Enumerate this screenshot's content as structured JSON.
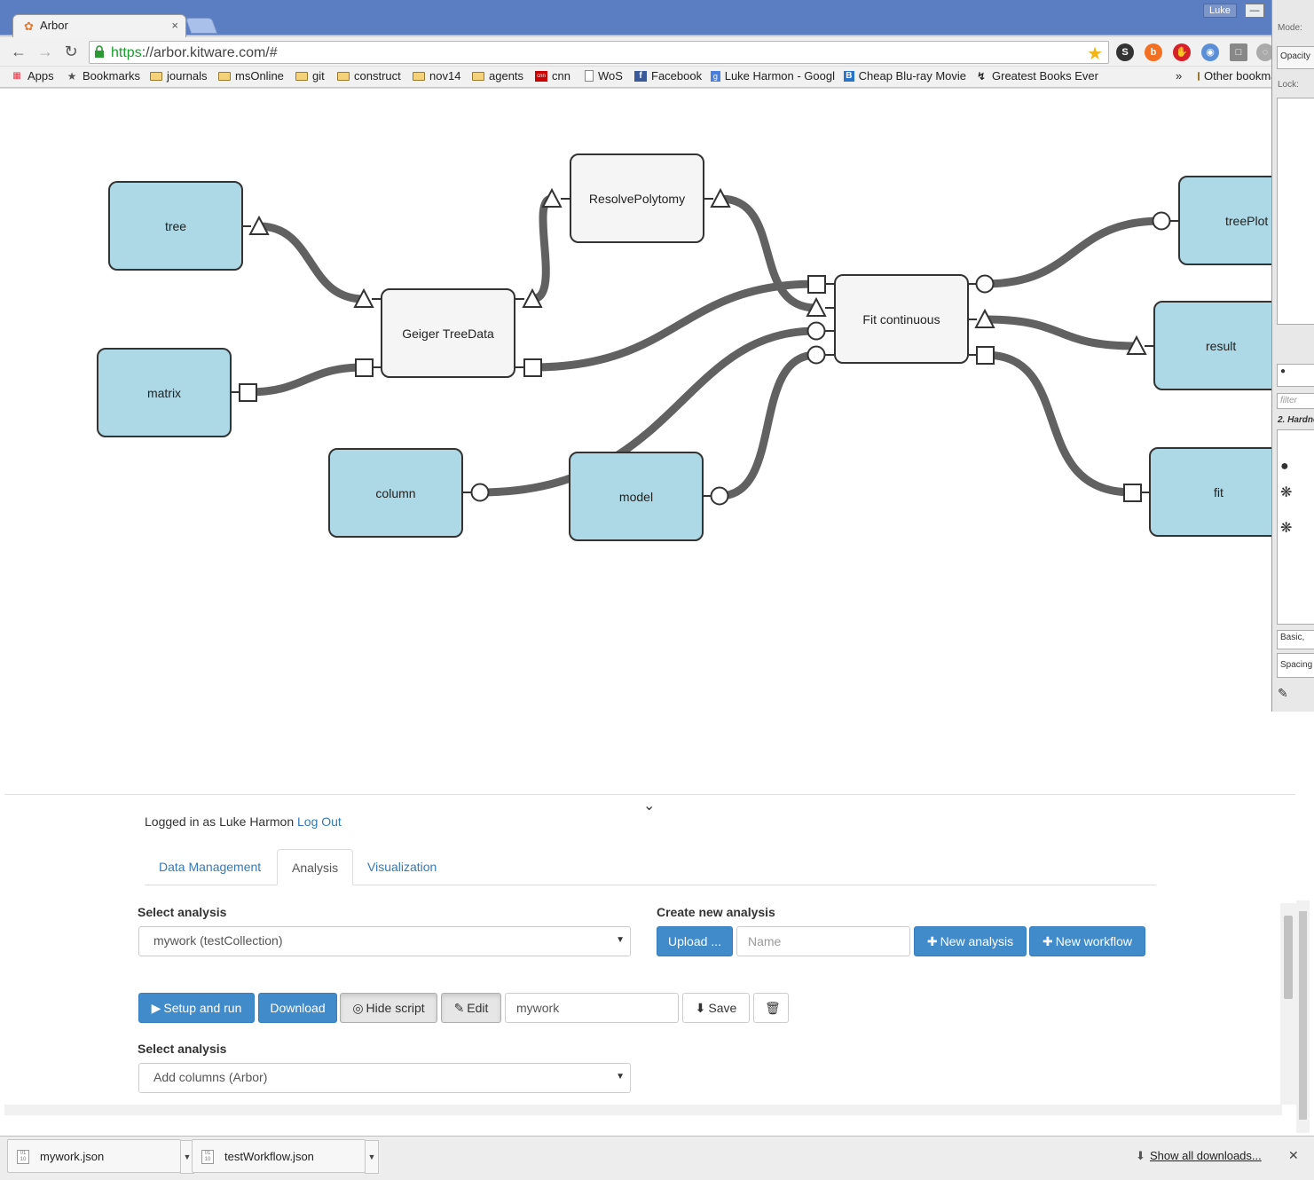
{
  "browser": {
    "tab_title": "Arbor",
    "profile_name": "Luke",
    "url_scheme": "https",
    "url_rest": "://arbor.kitware.com/#",
    "bookmarks": [
      "Apps",
      "Bookmarks",
      "journals",
      "msOnline",
      "git",
      "construct",
      "nov14",
      "agents",
      "cnn",
      "WoS",
      "Facebook",
      "Luke Harmon - Googl",
      "Cheap Blu-ray Movie",
      "Greatest Books Ever"
    ],
    "overflow": "»",
    "other_bookmarks": "Other bookmarks"
  },
  "workflow": {
    "nodes": {
      "tree": "tree",
      "matrix": "matrix",
      "geiger": "Geiger TreeData",
      "resolve": "ResolvePolytomy",
      "column": "column",
      "model": "model",
      "fit_continuous": "Fit continuous",
      "treeplot": "treePlot",
      "result": "result",
      "fit": "fit"
    },
    "wire_color": "#616161",
    "data_color": "#add8e6",
    "process_color": "#f5f5f5"
  },
  "panel": {
    "logged_in_prefix": "Logged in as Luke Harmon",
    "logout": "Log Out",
    "tabs": [
      "Data Management",
      "Analysis",
      "Visualization"
    ],
    "active_tab": "Analysis",
    "select_analysis_label": "Select analysis",
    "selected_analysis": "mywork (testCollection)",
    "create_label": "Create new analysis",
    "upload_btn": "Upload ...",
    "name_placeholder": "Name",
    "new_analysis_btn": "New analysis",
    "new_workflow_btn": "New workflow",
    "setup_run_btn": "Setup and run",
    "download_btn": "Download",
    "hide_script_btn": "Hide script",
    "edit_btn": "Edit",
    "analysis_name_value": "mywork",
    "save_btn": "Save",
    "select_analysis_label_2": "Select analysis",
    "selected_analysis_2": "Add columns (Arbor)"
  },
  "downloads": {
    "files": [
      "mywork.json",
      "testWorkflow.json"
    ],
    "show_all": "Show all downloads..."
  },
  "side_panel": {
    "mode_label": "Mode:",
    "opacity_label": "Opacity",
    "lock_label": "Lock:",
    "filter_placeholder": "filter",
    "brush_label": "2. Hardne",
    "preset_label": "Basic,",
    "spacing_label": "Spacing"
  }
}
